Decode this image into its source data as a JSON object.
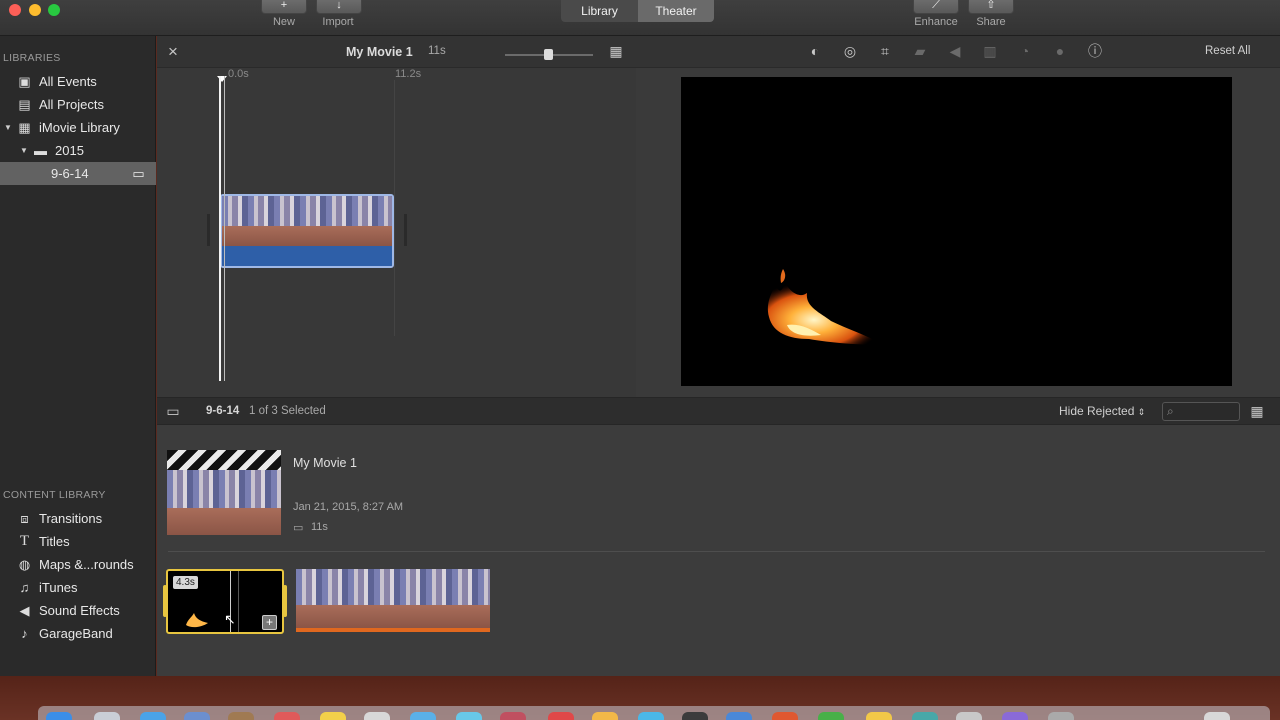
{
  "toolbar": {
    "new_label": "New",
    "import_label": "Import",
    "tab_library": "Library",
    "tab_theater": "Theater",
    "enhance_label": "Enhance",
    "share_label": "Share"
  },
  "sidebar": {
    "libraries_heading": "LIBRARIES",
    "items": [
      {
        "label": "All Events",
        "icon": "star-frame-icon"
      },
      {
        "label": "All Projects",
        "icon": "grid-icon"
      },
      {
        "label": "iMovie Library",
        "icon": "library-icon"
      },
      {
        "label": "2015",
        "icon": "folder-icon"
      },
      {
        "label": "9-6-14",
        "icon": "clapper-icon"
      }
    ],
    "content_heading": "CONTENT LIBRARY",
    "content_items": [
      {
        "label": "Transitions",
        "icon": "transitions-icon"
      },
      {
        "label": "Titles",
        "icon": "titles-icon"
      },
      {
        "label": "Maps &...rounds",
        "icon": "globe-icon"
      },
      {
        "label": "iTunes",
        "icon": "music-note-icon"
      },
      {
        "label": "Sound Effects",
        "icon": "speaker-icon"
      },
      {
        "label": "GarageBand",
        "icon": "guitar-icon"
      }
    ]
  },
  "timeline": {
    "project_title": "My Movie 1",
    "duration": "11s",
    "ruler_start": "0.0s",
    "ruler_mark": "11.2s"
  },
  "viewer": {
    "reset_all": "Reset All"
  },
  "filterbar": {
    "event_name": "9-6-14",
    "selection_status": "1 of 3 Selected",
    "hide_rejected": "Hide Rejected",
    "search_placeholder": ""
  },
  "project": {
    "title": "My Movie 1",
    "date": "Jan 21, 2015, 8:27 AM",
    "duration": "11s"
  },
  "clips": {
    "selected_duration": "4.3s"
  },
  "colors": {
    "accent_blue": "#2e5fa8",
    "selection_yellow": "#e8c640",
    "tab_active": "#6a6a6a"
  }
}
